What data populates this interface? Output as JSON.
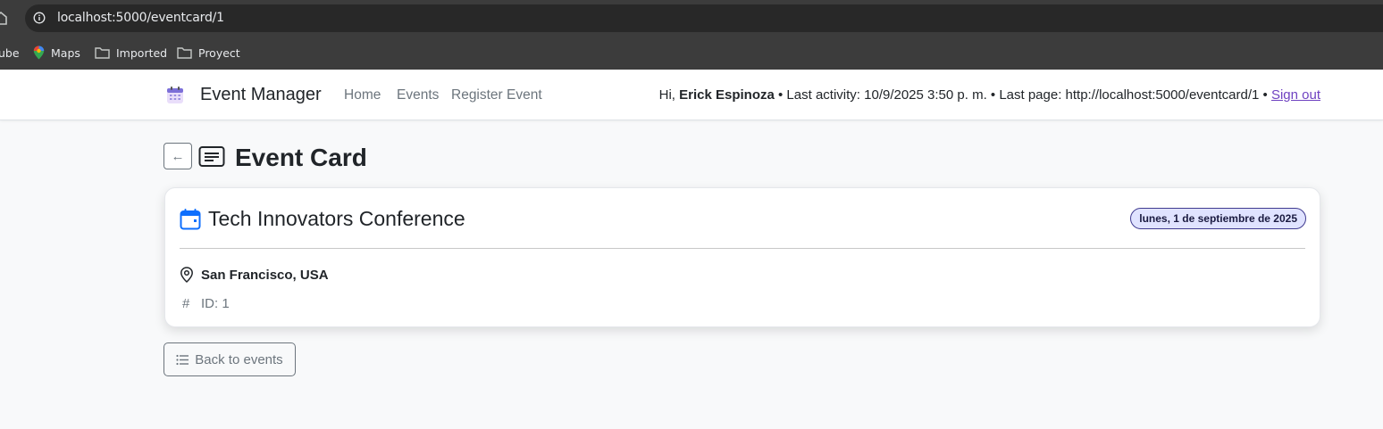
{
  "browser": {
    "url": "localhost:5000/eventcard/1",
    "bookmarks": [
      {
        "label": "ube",
        "icon": "youtube-icon"
      },
      {
        "label": "Maps",
        "icon": "maps-icon"
      },
      {
        "label": "Imported",
        "icon": "folder-icon"
      },
      {
        "label": "Proyect",
        "icon": "folder-icon"
      }
    ]
  },
  "navbar": {
    "brand": "Event Manager",
    "links": [
      "Home",
      "Events",
      "Register Event"
    ],
    "greeting": "Hi,",
    "user_name": "Erick Espinoza",
    "activity": "• Last activity: 10/9/2025 3:50 p. m. • Last page: http://localhost:5000/eventcard/1 •",
    "signout": "Sign out"
  },
  "page": {
    "back_arrow": "←",
    "title": "Event Card"
  },
  "event": {
    "title": "Tech Innovators Conference",
    "date": "lunes, 1 de septiembre de 2025",
    "location": "San Francisco, USA",
    "hash": "#",
    "id_text": "ID: 1"
  },
  "actions": {
    "back_to_events": "Back to events"
  },
  "colors": {
    "accent": "#0d6efd",
    "badge_bg": "#e0e3ff",
    "badge_border": "#3f3a8f",
    "signout_link": "#6f42c1"
  }
}
